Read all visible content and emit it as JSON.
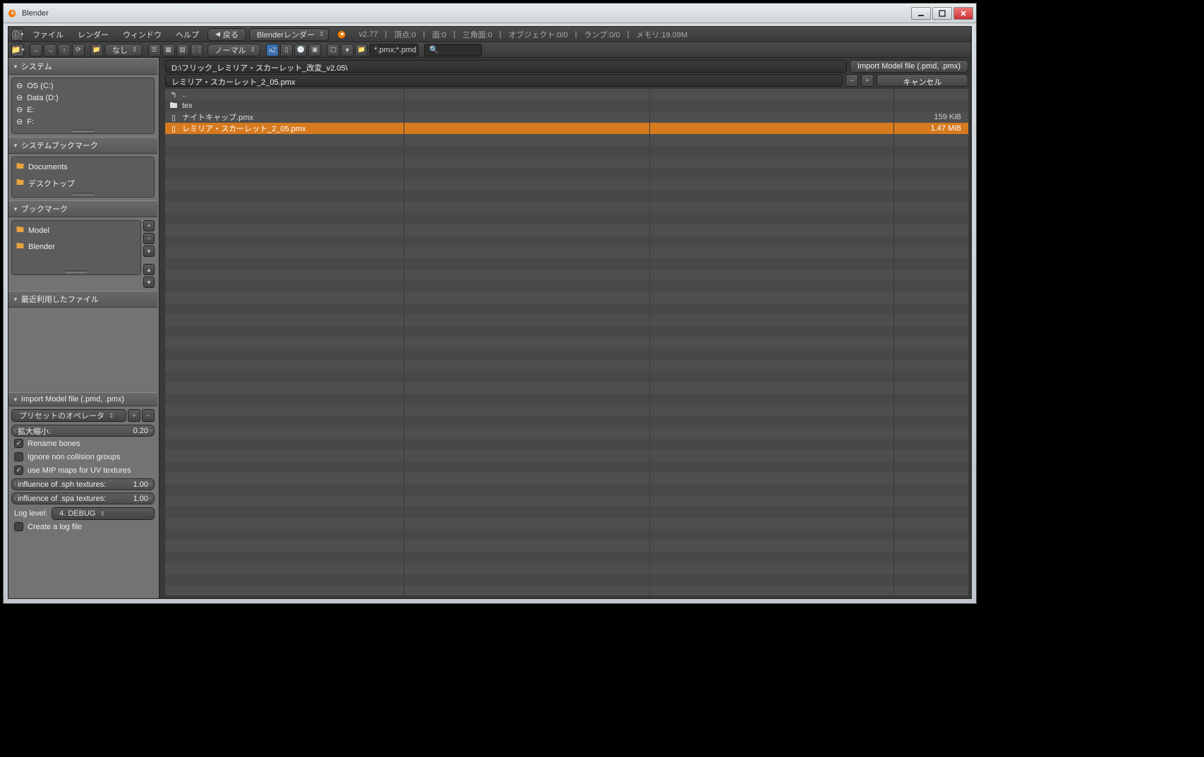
{
  "window": {
    "title": "Blender"
  },
  "menu": {
    "file": "ファイル",
    "render": "レンダー",
    "window": "ウィンドウ",
    "help": "ヘルプ",
    "back": "戻る",
    "engine": "Blenderレンダー"
  },
  "status": {
    "version": "v2.77",
    "verts": "頂点:0",
    "faces": "面:0",
    "tris": "三角面:0",
    "objects": "オブジェクト:0/0",
    "lamps": "ランプ:0/0",
    "memory": "メモリ:19.09M"
  },
  "toolbar": {
    "display": "なし",
    "sort": "ノーマル",
    "filter": "*.pmx;*.pmd",
    "search_placeholder": ""
  },
  "path": {
    "dir": "D:\\フリック_レミリア・スカーレット_改変_v2.05\\",
    "file": "レミリア・スカーレット_2_05.pmx"
  },
  "actions": {
    "import": "Import Model file (.pmd, .pmx)",
    "cancel": "キャンセル"
  },
  "sidebar": {
    "system": {
      "title": "システム",
      "items": [
        {
          "label": "OS (C:)"
        },
        {
          "label": "Data (D:)"
        },
        {
          "label": "E:"
        },
        {
          "label": "F:"
        }
      ]
    },
    "sysbook": {
      "title": "システムブックマーク",
      "items": [
        {
          "label": "Documents"
        },
        {
          "label": "デスクトップ"
        }
      ]
    },
    "bookmark": {
      "title": "ブックマーク",
      "items": [
        {
          "label": "Model"
        },
        {
          "label": "Blender"
        }
      ]
    },
    "recent": {
      "title": "最近利用したファイル"
    },
    "import": {
      "title": "Import Model file (.pmd, .pmx)",
      "preset": "プリセットのオペレータ",
      "scale_label": "拡大縮小:",
      "scale_value": "0.20",
      "rename": "Rename bones",
      "ignore": "Ignore  non collision groups",
      "mip": "use MIP maps for UV textures",
      "sph_label": "influence of .sph textures:",
      "sph_value": "1.00",
      "spa_label": "influence of .spa textures:",
      "spa_value": "1.00",
      "log_label": "Log level:",
      "log_value": "4. DEBUG",
      "createlog": "Create a log file"
    }
  },
  "files": {
    "parent": "..",
    "items": [
      {
        "name": "tex",
        "type": "folder",
        "size": ""
      },
      {
        "name": "ナイトキャップ.pmx",
        "type": "file",
        "size": "159 KiB"
      },
      {
        "name": "レミリア・スカーレット_2_05.pmx",
        "type": "file",
        "size": "1.47 MiB",
        "selected": true
      }
    ]
  }
}
